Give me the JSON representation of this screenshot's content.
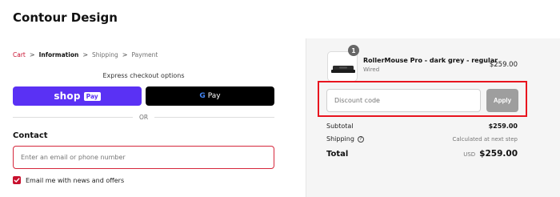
{
  "store": {
    "title": "Contour Design"
  },
  "breadcrumb": {
    "cart": "Cart",
    "information": "Information",
    "shipping": "Shipping",
    "payment": "Payment",
    "separator": ">"
  },
  "express": {
    "label": "Express checkout options",
    "shop_pay_word": "shop",
    "shop_pay_badge": "Pay",
    "gpay_g": "G",
    "gpay_word": "Pay",
    "or_text": "OR"
  },
  "contact": {
    "heading": "Contact",
    "email_placeholder": "Enter an email or phone number",
    "newsletter_label": "Email me with news and offers",
    "newsletter_checked": true
  },
  "order": {
    "item": {
      "quantity": "1",
      "name": "RollerMouse Pro - dark grey - regular",
      "variant": "Wired",
      "price": "$259.00"
    },
    "discount": {
      "placeholder": "Discount code",
      "apply_label": "Apply"
    },
    "subtotal_label": "Subtotal",
    "subtotal_value": "$259.00",
    "shipping_label": "Shipping",
    "shipping_value": "Calculated at next step",
    "total_label": "Total",
    "currency": "USD",
    "total_value": "$259.00"
  },
  "colors": {
    "accent": "#c8102e",
    "shop_pay": "#5a31f4",
    "highlight": "#e8141e"
  }
}
